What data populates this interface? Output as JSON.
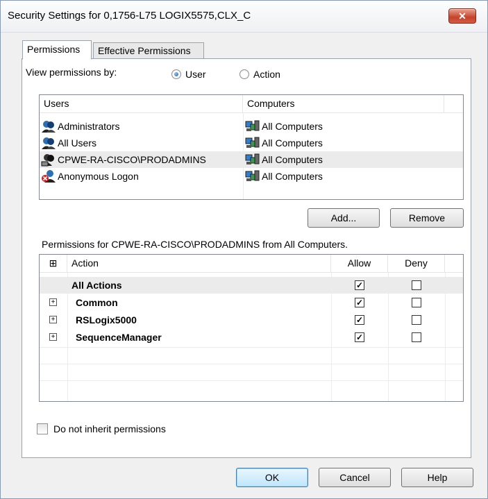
{
  "window": {
    "title": "Security Settings for 0,1756-L75 LOGIX5575,CLX_C",
    "close_glyph": "✕"
  },
  "tabs": [
    {
      "label": "Permissions",
      "active": true
    },
    {
      "label": "Effective Permissions",
      "active": false
    }
  ],
  "view_by": {
    "label": "View permissions by:",
    "options": [
      {
        "label": "User",
        "checked": true
      },
      {
        "label": "Action",
        "checked": false
      }
    ]
  },
  "users_list": {
    "columns": [
      "Users",
      "Computers"
    ],
    "rows": [
      {
        "user": "Administrators",
        "computer": "All Computers",
        "icon": "user-group-icon",
        "selected": false
      },
      {
        "user": "All Users",
        "computer": "All Computers",
        "icon": "user-group-icon",
        "selected": false
      },
      {
        "user": "CPWE-RA-CISCO\\PRODADMINS",
        "computer": "All Computers",
        "icon": "network-group-icon",
        "selected": true
      },
      {
        "user": "Anonymous Logon",
        "computer": "All Computers",
        "icon": "denied-user-icon",
        "selected": false
      }
    ]
  },
  "buttons": {
    "add": "Add...",
    "remove": "Remove",
    "ok": "OK",
    "cancel": "Cancel",
    "help": "Help"
  },
  "permissions_caption": "Permissions for CPWE-RA-CISCO\\PRODADMINS from All Computers.",
  "permissions_list": {
    "columns": {
      "expand": "⊞",
      "action": "Action",
      "allow": "Allow",
      "deny": "Deny"
    },
    "rows": [
      {
        "action": "All Actions",
        "expandable": false,
        "allow": true,
        "deny": false
      },
      {
        "action": "Common",
        "expandable": true,
        "allow": true,
        "deny": false
      },
      {
        "action": "RSLogix5000",
        "expandable": true,
        "allow": true,
        "deny": false
      },
      {
        "action": "SequenceManager",
        "expandable": true,
        "allow": true,
        "deny": false
      }
    ],
    "check_glyph": "✓",
    "expand_glyph": "+"
  },
  "inherit_checkbox": {
    "label": "Do not inherit permissions",
    "checked": false
  },
  "colors": {
    "close_button": "#c7422a",
    "selected_row": "#ebebeb",
    "default_button_border": "#3c7fb1"
  }
}
